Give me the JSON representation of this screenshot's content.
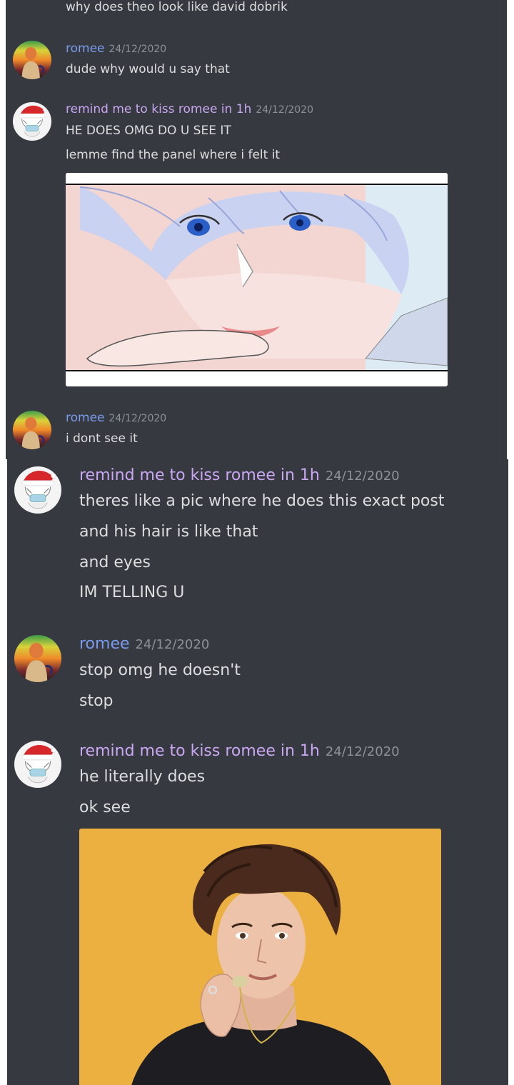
{
  "top_section": {
    "cutoff_message": "why does theo look like david dobrik",
    "messages": [
      {
        "author": "romee",
        "timestamp": "24/12/2020",
        "lines": [
          "dude why would u say that"
        ]
      },
      {
        "author": "remind me to kiss romee in 1h",
        "timestamp": "24/12/2020",
        "lines": [
          "HE DOES OMG DO U SEE IT",
          "lemme find the panel where i felt it"
        ]
      },
      {
        "author": "romee",
        "timestamp": "24/12/2020",
        "lines": [
          "i dont see it"
        ]
      }
    ]
  },
  "bottom_section": {
    "messages": [
      {
        "author": "remind me to kiss romee in 1h",
        "timestamp": "24/12/2020",
        "lines": [
          "theres like a pic where he does this exact post",
          "and his hair is like that",
          "and eyes",
          "IM TELLING U"
        ]
      },
      {
        "author": "romee",
        "timestamp": "24/12/2020",
        "lines": [
          "stop omg he doesn't",
          "stop"
        ]
      },
      {
        "author": "remind me to kiss romee in 1h",
        "timestamp": "24/12/2020",
        "lines": [
          "he literally does",
          "ok see"
        ]
      }
    ]
  },
  "colors": {
    "background": "#36393f",
    "text": "#dcddde",
    "romee_name": "#7a9bec",
    "remind_name": "#c9a7f2",
    "timestamp": "#8e9297"
  },
  "icons": {
    "romee_avatar": "rainbow-figure-avatar-icon",
    "remind_avatar": "santa-hat-anime-avatar-icon"
  }
}
